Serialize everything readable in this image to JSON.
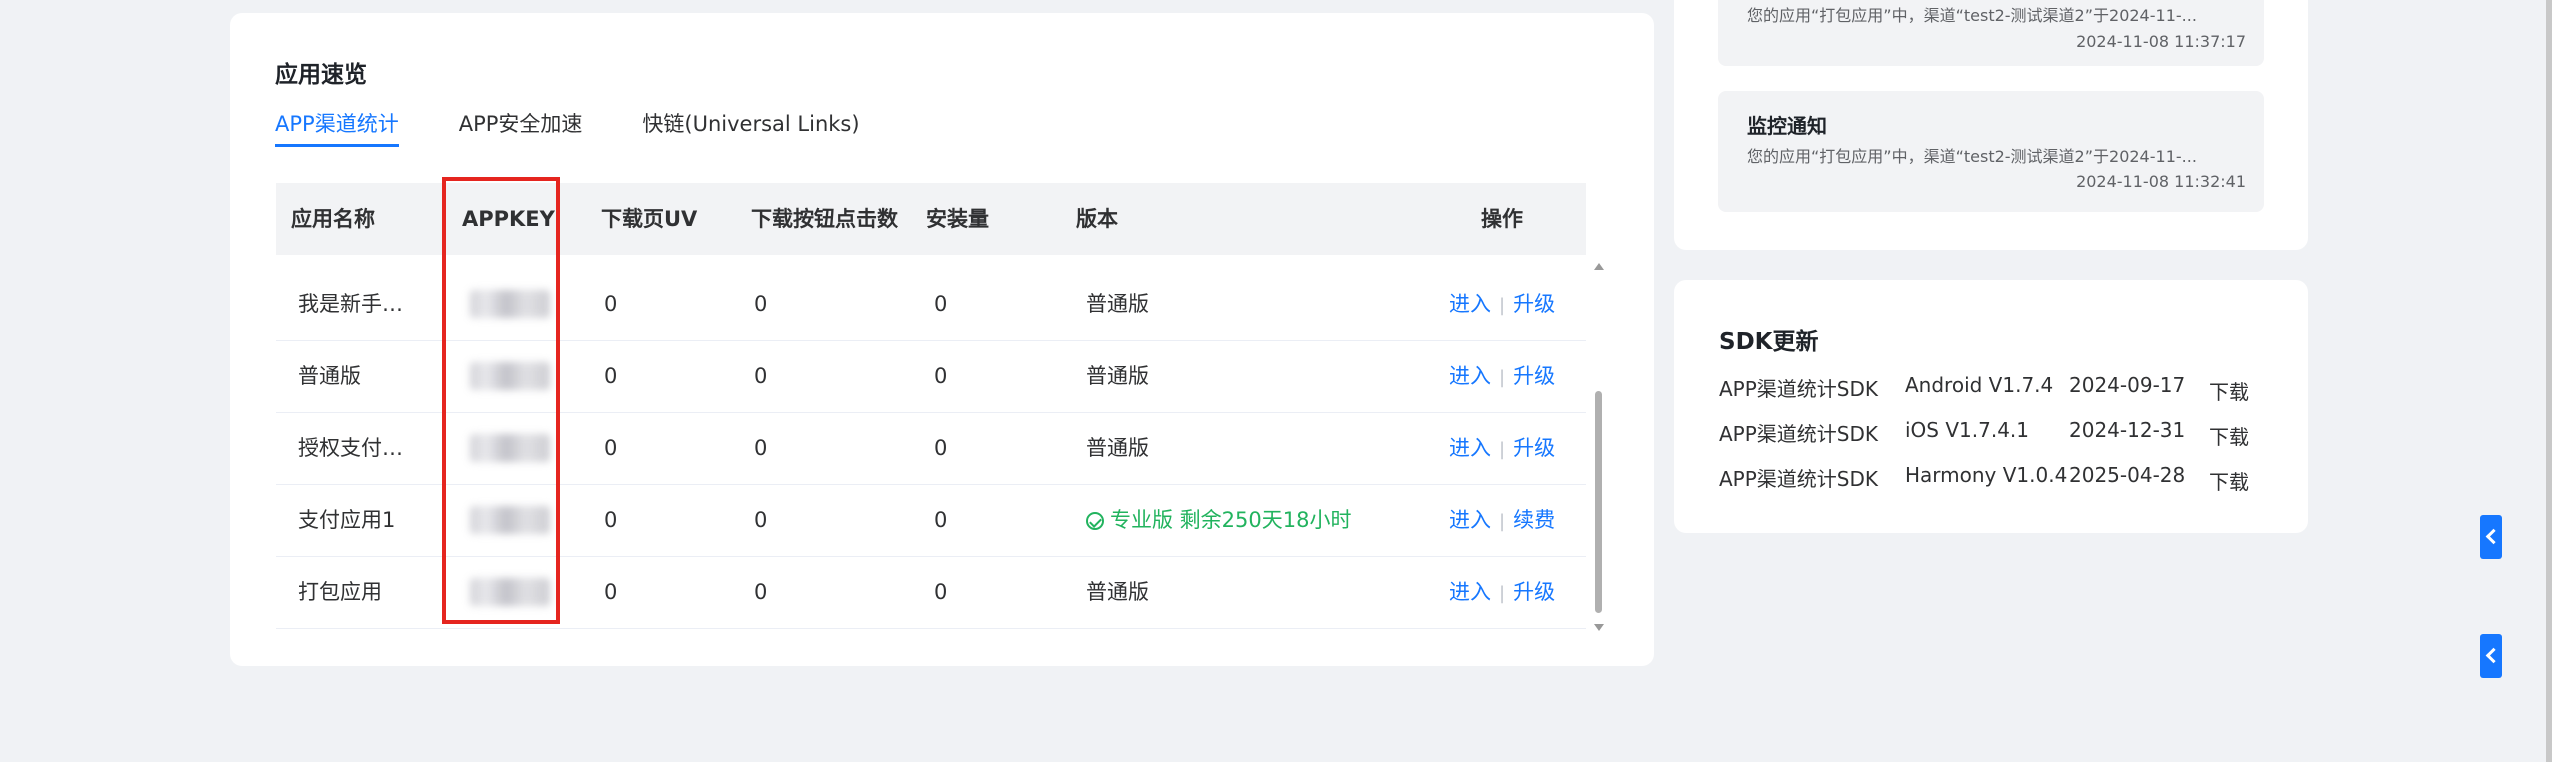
{
  "overview": {
    "title": "应用速览",
    "tabs": [
      "APP渠道统计",
      "APP安全加速",
      "快链(Universal Links)"
    ],
    "columns": [
      "应用名称",
      "APPKEY",
      "下载页UV",
      "下载按钮点击数",
      "安装量",
      "版本",
      "操作"
    ],
    "rows": [
      {
        "name": "我是新手…",
        "uv": "0",
        "clicks": "0",
        "installs": "0",
        "version": "普通版",
        "enter": "进入",
        "action": "升级"
      },
      {
        "name": "普通版",
        "uv": "0",
        "clicks": "0",
        "installs": "0",
        "version": "普通版",
        "enter": "进入",
        "action": "升级"
      },
      {
        "name": "授权支付…",
        "uv": "0",
        "clicks": "0",
        "installs": "0",
        "version": "普通版",
        "enter": "进入",
        "action": "升级"
      },
      {
        "name": "支付应用1",
        "uv": "0",
        "clicks": "0",
        "installs": "0",
        "version": "专业版 剩余250天18小时",
        "enter": "进入",
        "action": "续费"
      },
      {
        "name": "打包应用",
        "uv": "0",
        "clicks": "0",
        "installs": "0",
        "version": "普通版",
        "enter": "进入",
        "action": "升级"
      }
    ]
  },
  "notifications": [
    {
      "title": "",
      "text": "您的应用“打包应用”中，渠道“test2-测试渠道2”于2024-11-...",
      "time": "2024-11-08 11:37:17"
    },
    {
      "title": "监控通知",
      "text": "您的应用“打包应用”中，渠道“test2-测试渠道2”于2024-11-...",
      "time": "2024-11-08 11:32:41"
    }
  ],
  "sdk": {
    "title": "SDK更新",
    "rows": [
      {
        "name": "APP渠道统计SDK",
        "version": "Android V1.7.4",
        "date": "2024-09-17",
        "download": "下载"
      },
      {
        "name": "APP渠道统计SDK",
        "version": "iOS V1.7.4.1",
        "date": "2024-12-31",
        "download": "下载"
      },
      {
        "name": "APP渠道统计SDK",
        "version": "Harmony V1.0.4",
        "date": "2025-04-28",
        "download": "下载"
      }
    ]
  },
  "colors": {
    "accent": "#1677ff",
    "highlight": "#e5251f",
    "pro": "#22b35e"
  }
}
